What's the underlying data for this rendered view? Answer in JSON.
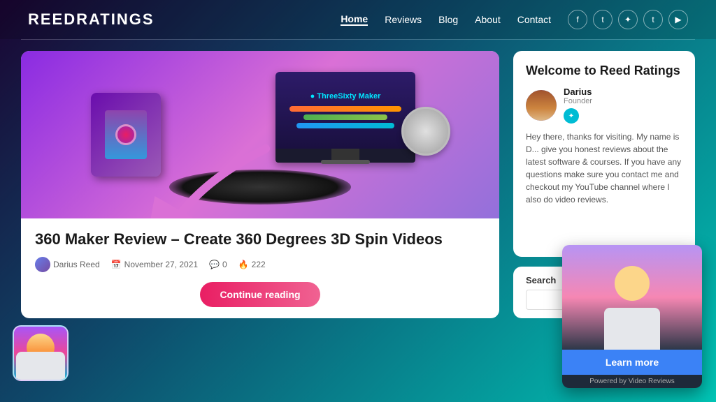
{
  "header": {
    "logo": "ReedRatings",
    "nav": [
      {
        "label": "Home",
        "active": true
      },
      {
        "label": "Reviews",
        "active": false
      },
      {
        "label": "Blog",
        "active": false
      },
      {
        "label": "About",
        "active": false
      },
      {
        "label": "Contact",
        "active": false
      }
    ],
    "social": [
      "f",
      "t",
      "p",
      "t",
      "yt"
    ]
  },
  "article": {
    "title": "360 Maker Review – Create 360 Degrees 3D Spin Videos",
    "author": "Darius Reed",
    "date": "November 27, 2021",
    "comments": "0",
    "views": "222",
    "continue_btn": "Continue reading"
  },
  "sidebar": {
    "welcome_title": "Welcome to Reed Ratings",
    "author_name": "Darius",
    "author_role": "Founder",
    "welcome_text": "Hey there, thanks for visiting. My name is D... give you honest reviews about the latest software & courses. If you have any questions make sure you contact me and checkout my YouTube channel where I also do video reviews.",
    "search_label": "Search",
    "search_placeholder": ""
  },
  "video_popup": {
    "learn_btn": "Learn more",
    "powered_text": "Powered by Video Reviews"
  }
}
